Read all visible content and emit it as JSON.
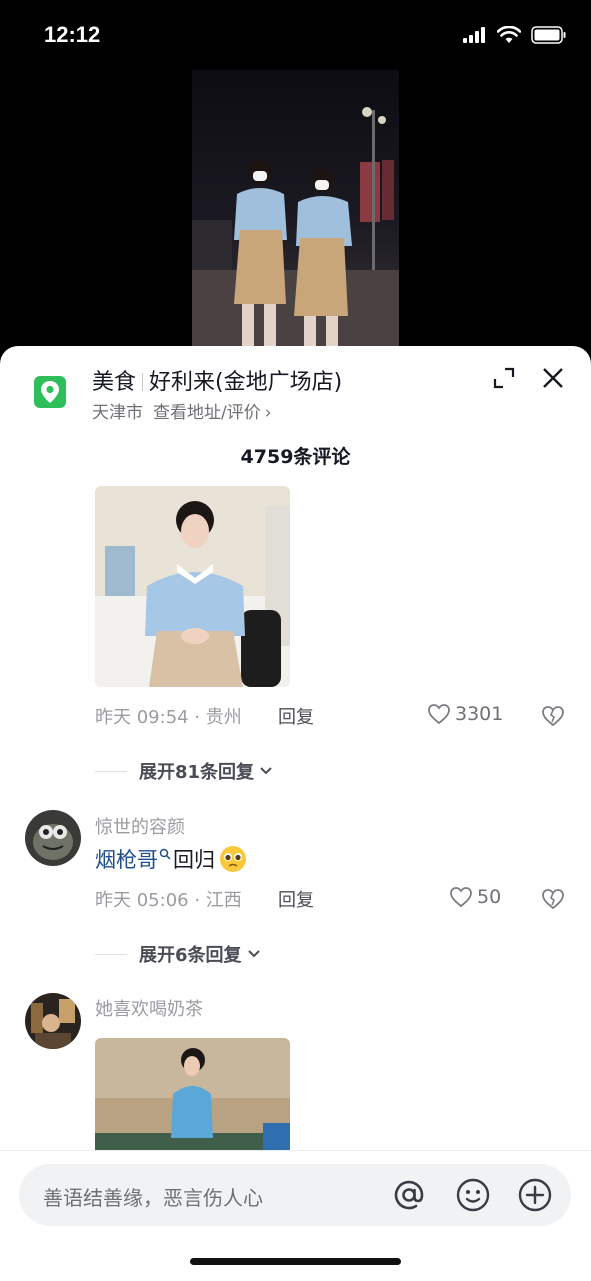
{
  "status_bar": {
    "time": "12:12"
  },
  "poi": {
    "category": "美食",
    "name": "好利来(金地广场店)",
    "city": "天津市",
    "link": "查看地址/评价",
    "link_chevron": "›",
    "icon": "location-pin-icon",
    "color": "#2fbf5a"
  },
  "comments_header": {
    "count_label": "4759条评论"
  },
  "comments": [
    {
      "time_location": "昨天 09:54 · 贵州",
      "reply_label": "回复",
      "likes": "3301",
      "expand_label": "展开81条回复"
    },
    {
      "username": "惊世的容颜",
      "mention": "烟枪哥",
      "text": "回归",
      "emoji": "🥺",
      "time_location": "昨天 05:06 · 江西",
      "reply_label": "回复",
      "likes": "50",
      "expand_label": "展开6条回复"
    },
    {
      "username": "她喜欢喝奶茶"
    }
  ],
  "input_bar": {
    "placeholder": "善语结善缘，恶言伤人心",
    "icons": [
      "at-icon",
      "emoji-icon",
      "plus-icon"
    ]
  }
}
